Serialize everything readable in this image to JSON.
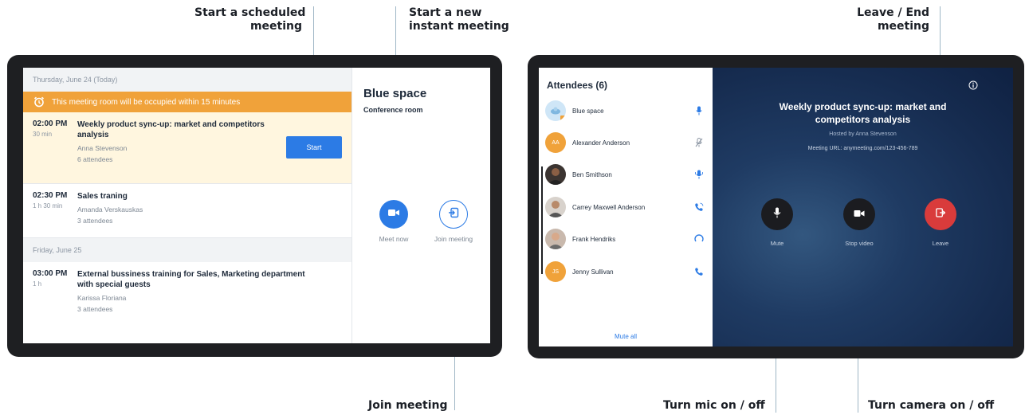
{
  "callouts": {
    "start_scheduled": [
      "Start a scheduled",
      "meeting"
    ],
    "start_instant": [
      "Start a new",
      "instant meeting"
    ],
    "join_meeting": "Join meeting",
    "leave_end": [
      "Leave / End",
      "meeting"
    ],
    "mic": "Turn mic on / off",
    "camera": "Turn camera on / off"
  },
  "schedule": {
    "day1": "Thursday, June 24 (Today)",
    "warning": "This meeting room will be occupied within 15 minutes",
    "events": [
      {
        "time": "02:00 PM",
        "duration": "30 min",
        "title": "Weekly product sync-up: market and competitors analysis",
        "host": "Anna Stevenson",
        "attendees": "6 attendees"
      },
      {
        "time": "02:30 PM",
        "duration": "1 h 30 min",
        "title": "Sales traning",
        "host": "Amanda Verskauskas",
        "attendees": "3 attendees"
      },
      {
        "time": "03:00 PM",
        "duration": "1 h",
        "title": "External bussiness training for Sales, Marketing department with special guests",
        "host": "Karissa Floriana",
        "attendees": "3 attendees"
      }
    ],
    "day2": "Friday, June 25",
    "start_label": "Start"
  },
  "room": {
    "name": "Blue space",
    "type": "Conference room",
    "meet_now": "Meet now",
    "join": "Join meeting"
  },
  "attendees": {
    "title": "Attendees (6)",
    "list": [
      {
        "name": "Blue space",
        "initials": "",
        "mic": "mic-on"
      },
      {
        "name": "Alexander Anderson",
        "initials": "AA",
        "mic": "mic-off"
      },
      {
        "name": "Ben Smithson",
        "initials": "",
        "mic": "mic-active"
      },
      {
        "name": "Carrey Maxwell Anderson",
        "initials": "",
        "mic": "phone"
      },
      {
        "name": "Frank Hendriks",
        "initials": "",
        "mic": "connecting"
      },
      {
        "name": "Jenny Sullivan",
        "initials": "JS",
        "mic": "phone"
      }
    ],
    "mute_all": "Mute all"
  },
  "call": {
    "title": [
      "Weekly product sync-up: market and",
      "competitors analysis"
    ],
    "host": "Hosted by Anna Stevenson",
    "url": "Meeting URL: anymeeting.com/123-456-789",
    "mute": "Mute",
    "stop_video": "Stop video",
    "leave": "Leave"
  },
  "colors": {
    "accent": "#2c7be5",
    "warning": "#f0a23a",
    "active_event": "#fff6df",
    "leave": "#d93b3b",
    "control_dark": "#1b1c20"
  }
}
